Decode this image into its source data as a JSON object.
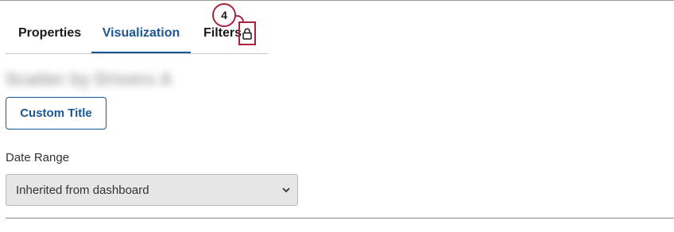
{
  "step_badge": "4",
  "tabs": [
    {
      "label": "Properties"
    },
    {
      "label": "Visualization",
      "active": true
    },
    {
      "label": "Filters",
      "icon": "lock-icon"
    }
  ],
  "widget_title_blurred": "Scatter by Drivers A",
  "custom_title_button": "Custom Title",
  "date_range": {
    "label": "Date Range",
    "selected": "Inherited from dashboard"
  },
  "colors": {
    "accent": "#1a5794",
    "highlight": "#b0203a",
    "select_bg": "#e6e6e6"
  }
}
